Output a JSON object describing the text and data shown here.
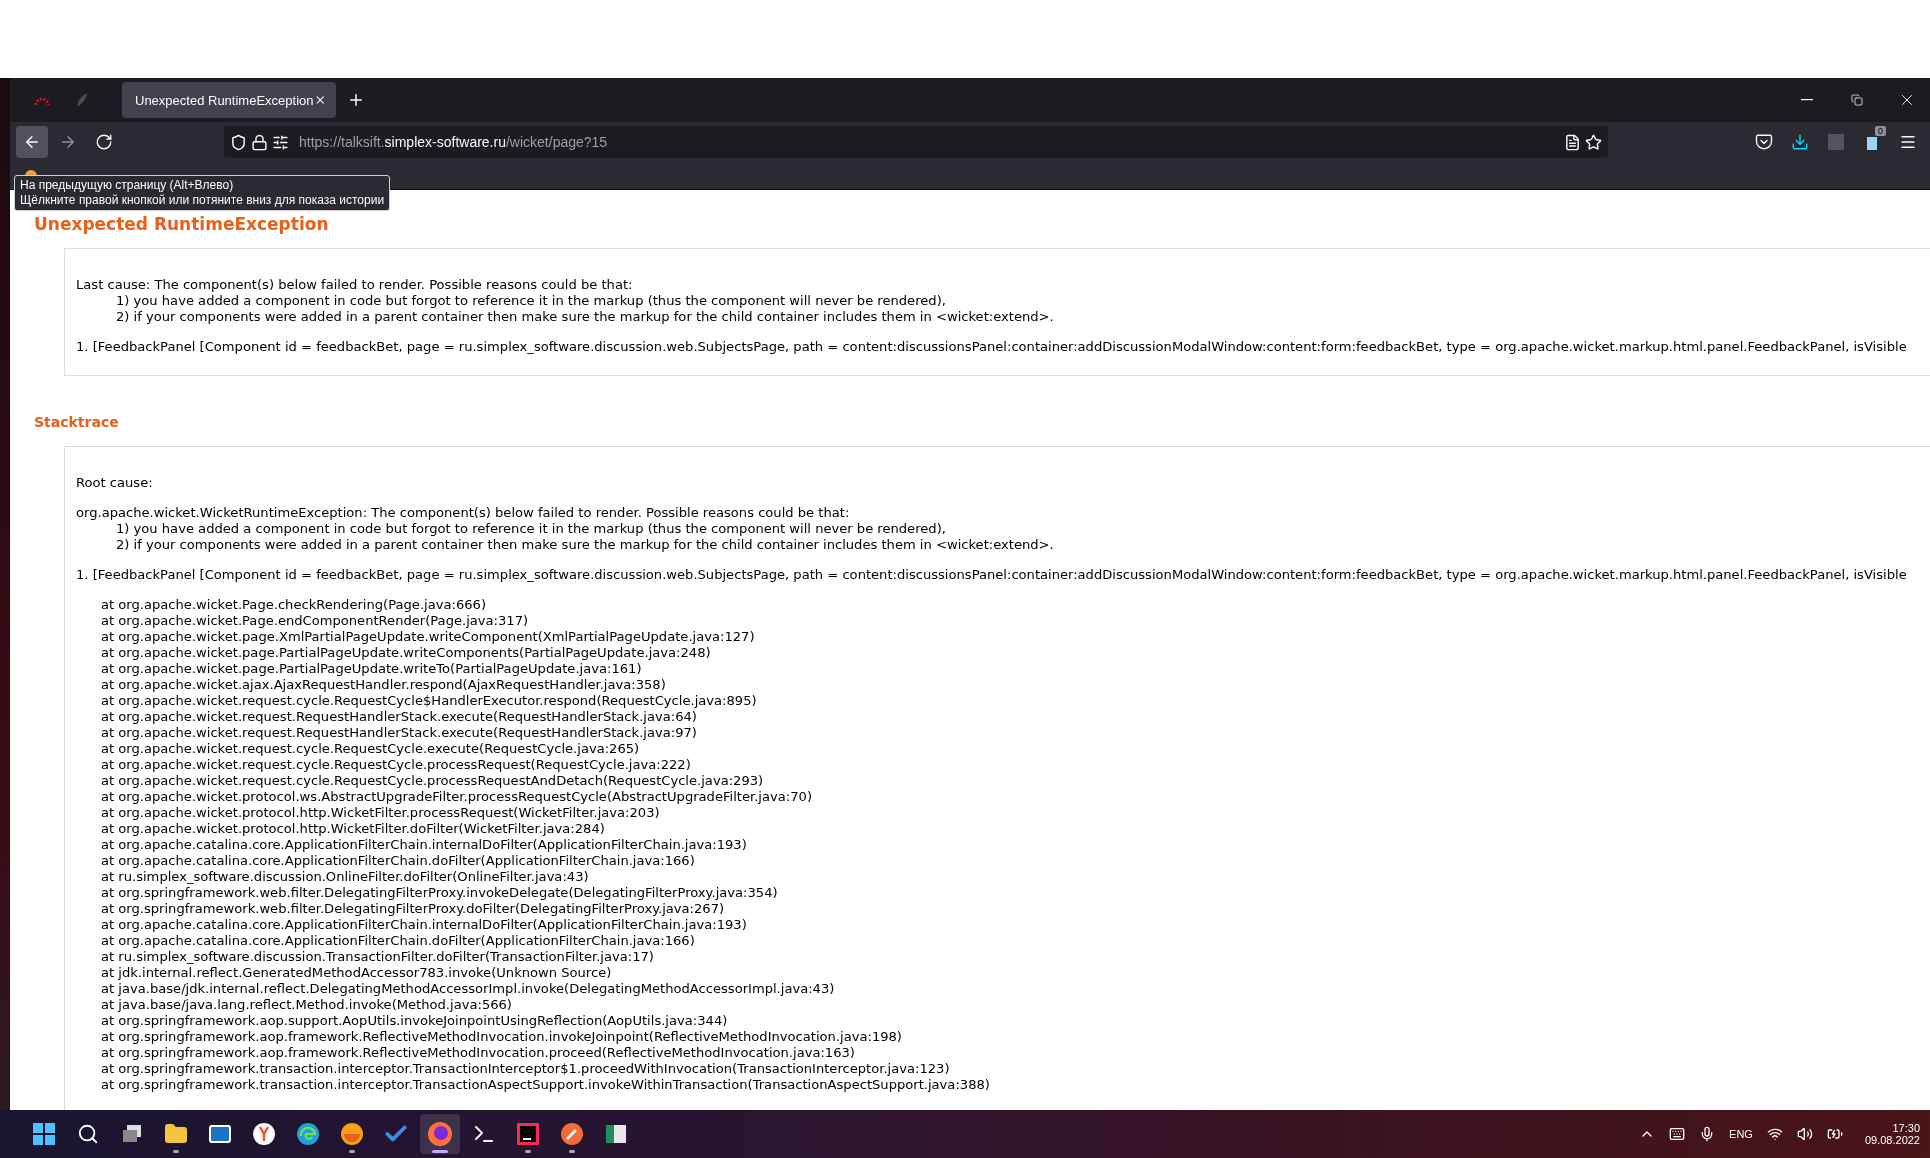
{
  "browser": {
    "pinned_tabs": [
      {
        "kind": "arc"
      },
      {
        "kind": "feather"
      }
    ],
    "tabs": [
      {
        "title": "Unexpected RuntimeException",
        "selected": true
      }
    ],
    "address": {
      "prefix": "https://talksift.",
      "domain": "simplex-software.ru",
      "path": "/wicket/page?15"
    },
    "extension_badge": "0",
    "tooltip": [
      "На предыдущую страницу (Alt+Влево)",
      "Щёлкните правой кнопкой или потяните вниз для показа истории"
    ]
  },
  "page": {
    "title": "Unexpected RuntimeException",
    "last_cause": {
      "intro": "Last cause: The component(s) below failed to render. Possible reasons could be that:",
      "reasons": [
        "1) you have added a component in code but forgot to reference it in the markup (thus the component will never be rendered),",
        "2) if your components were added in a parent container then make sure the markup for the child container includes them in <wicket:extend>."
      ],
      "component": "1. [FeedbackPanel [Component id = feedbackBet, page = ru.simplex_software.discussion.web.SubjectsPage, path = content:discussionsPanel:container:addDiscussionModalWindow:content:form:feedbackBet, type = org.apache.wicket.markup.html.panel.FeedbackPanel, isVisible"
    },
    "stacktrace_heading": "Stacktrace",
    "root_cause": {
      "label": "Root cause:",
      "intro": "org.apache.wicket.WicketRuntimeException: The component(s) below failed to render. Possible reasons could be that:",
      "reasons": [
        "1) you have added a component in code but forgot to reference it in the markup (thus the component will never be rendered),",
        "2) if your components were added in a parent container then make sure the markup for the child container includes them in <wicket:extend>."
      ],
      "component": "1. [FeedbackPanel [Component id = feedbackBet, page = ru.simplex_software.discussion.web.SubjectsPage, path = content:discussionsPanel:container:addDiscussionModalWindow:content:form:feedbackBet, type = org.apache.wicket.markup.html.panel.FeedbackPanel, isVisible",
      "frames": [
        "at org.apache.wicket.Page.checkRendering(Page.java:666)",
        "at org.apache.wicket.Page.endComponentRender(Page.java:317)",
        "at org.apache.wicket.page.XmlPartialPageUpdate.writeComponent(XmlPartialPageUpdate.java:127)",
        "at org.apache.wicket.page.PartialPageUpdate.writeComponents(PartialPageUpdate.java:248)",
        "at org.apache.wicket.page.PartialPageUpdate.writeTo(PartialPageUpdate.java:161)",
        "at org.apache.wicket.ajax.AjaxRequestHandler.respond(AjaxRequestHandler.java:358)",
        "at org.apache.wicket.request.cycle.RequestCycle$HandlerExecutor.respond(RequestCycle.java:895)",
        "at org.apache.wicket.request.RequestHandlerStack.execute(RequestHandlerStack.java:64)",
        "at org.apache.wicket.request.RequestHandlerStack.execute(RequestHandlerStack.java:97)",
        "at org.apache.wicket.request.cycle.RequestCycle.execute(RequestCycle.java:265)",
        "at org.apache.wicket.request.cycle.RequestCycle.processRequest(RequestCycle.java:222)",
        "at org.apache.wicket.request.cycle.RequestCycle.processRequestAndDetach(RequestCycle.java:293)",
        "at org.apache.wicket.protocol.ws.AbstractUpgradeFilter.processRequestCycle(AbstractUpgradeFilter.java:70)",
        "at org.apache.wicket.protocol.http.WicketFilter.processRequest(WicketFilter.java:203)",
        "at org.apache.wicket.protocol.http.WicketFilter.doFilter(WicketFilter.java:284)",
        "at org.apache.catalina.core.ApplicationFilterChain.internalDoFilter(ApplicationFilterChain.java:193)",
        "at org.apache.catalina.core.ApplicationFilterChain.doFilter(ApplicationFilterChain.java:166)",
        "at ru.simplex_software.discussion.OnlineFilter.doFilter(OnlineFilter.java:43)",
        "at org.springframework.web.filter.DelegatingFilterProxy.invokeDelegate(DelegatingFilterProxy.java:354)",
        "at org.springframework.web.filter.DelegatingFilterProxy.doFilter(DelegatingFilterProxy.java:267)",
        "at org.apache.catalina.core.ApplicationFilterChain.internalDoFilter(ApplicationFilterChain.java:193)",
        "at org.apache.catalina.core.ApplicationFilterChain.doFilter(ApplicationFilterChain.java:166)",
        "at ru.simplex_software.discussion.TransactionFilter.doFilter(TransactionFilter.java:17)",
        "at jdk.internal.reflect.GeneratedMethodAccessor783.invoke(Unknown Source)",
        "at java.base/jdk.internal.reflect.DelegatingMethodAccessorImpl.invoke(DelegatingMethodAccessorImpl.java:43)",
        "at java.base/java.lang.reflect.Method.invoke(Method.java:566)",
        "at org.springframework.aop.support.AopUtils.invokeJoinpointUsingReflection(AopUtils.java:344)",
        "at org.springframework.aop.framework.ReflectiveMethodInvocation.invokeJoinpoint(ReflectiveMethodInvocation.java:198)",
        "at org.springframework.aop.framework.ReflectiveMethodInvocation.proceed(ReflectiveMethodInvocation.java:163)",
        "at org.springframework.transaction.interceptor.TransactionInterceptor$1.proceedWithInvocation(TransactionInterceptor.java:123)",
        "at org.springframework.transaction.interceptor.TransactionAspectSupport.invokeWithinTransaction(TransactionAspectSupport.java:388)"
      ]
    }
  },
  "taskbar": {
    "apps": [
      {
        "kind": "start",
        "running": false,
        "selected": false
      },
      {
        "kind": "search",
        "running": false,
        "selected": false
      },
      {
        "kind": "taskview",
        "running": false,
        "selected": false
      },
      {
        "kind": "folder",
        "running": true,
        "selected": false
      },
      {
        "kind": "mail",
        "running": false,
        "selected": false
      },
      {
        "kind": "yandex",
        "running": false,
        "selected": false
      },
      {
        "kind": "edge",
        "running": false,
        "selected": false
      },
      {
        "kind": "orange",
        "running": true,
        "selected": false
      },
      {
        "kind": "check",
        "running": false,
        "selected": false
      },
      {
        "kind": "firefox",
        "running": true,
        "selected": true
      },
      {
        "kind": "terminal",
        "running": false,
        "selected": false
      },
      {
        "kind": "ide",
        "running": true,
        "selected": false
      },
      {
        "kind": "pen",
        "running": true,
        "selected": false
      },
      {
        "kind": "sheet",
        "running": false,
        "selected": false
      }
    ],
    "language": "ENG",
    "time": "17:30",
    "date": "09.08.2022"
  }
}
